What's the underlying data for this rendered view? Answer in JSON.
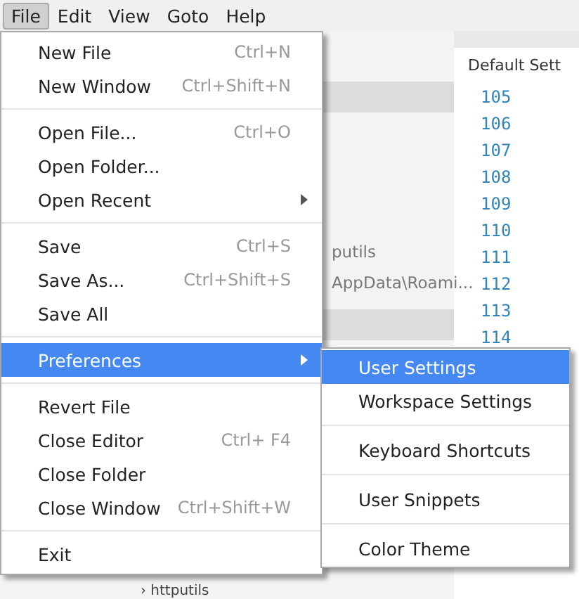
{
  "menubar": [
    {
      "label": "File",
      "selected": true
    },
    {
      "label": "Edit",
      "selected": false
    },
    {
      "label": "View",
      "selected": false
    },
    {
      "label": "Goto",
      "selected": false
    },
    {
      "label": "Help",
      "selected": false
    }
  ],
  "sidebar": {
    "items": [
      {
        "selected": true
      },
      {
        "label": "putils",
        "selected": false
      },
      {
        "label": "AppData\\Roami...",
        "selected": false
      },
      {
        "selected": true
      }
    ],
    "footer": "› httputils"
  },
  "editor": {
    "tab": "Default Sett",
    "line_numbers": [
      "105",
      "106",
      "107",
      "108",
      "109",
      "110",
      "111",
      "112",
      "113",
      "114"
    ]
  },
  "file_menu": [
    {
      "kind": "item",
      "label": "New File",
      "shortcut": "Ctrl+N",
      "submenu": false,
      "selected": false
    },
    {
      "kind": "item",
      "label": "New Window",
      "shortcut": "Ctrl+Shift+N",
      "submenu": false,
      "selected": false
    },
    {
      "kind": "separator"
    },
    {
      "kind": "item",
      "label": "Open File...",
      "shortcut": "Ctrl+O",
      "submenu": false,
      "selected": false
    },
    {
      "kind": "item",
      "label": "Open Folder...",
      "submenu": false,
      "selected": false
    },
    {
      "kind": "item",
      "label": "Open Recent",
      "submenu": true,
      "selected": false
    },
    {
      "kind": "separator"
    },
    {
      "kind": "item",
      "label": "Save",
      "shortcut": "Ctrl+S",
      "submenu": false,
      "selected": false
    },
    {
      "kind": "item",
      "label": "Save As...",
      "shortcut": "Ctrl+Shift+S",
      "submenu": false,
      "selected": false
    },
    {
      "kind": "item",
      "label": "Save All",
      "submenu": false,
      "selected": false
    },
    {
      "kind": "separator"
    },
    {
      "kind": "item",
      "label": "Preferences",
      "submenu": true,
      "selected": true
    },
    {
      "kind": "separator"
    },
    {
      "kind": "item",
      "label": "Revert File",
      "submenu": false,
      "selected": false
    },
    {
      "kind": "item",
      "label": "Close Editor",
      "shortcut": "Ctrl+  F4",
      "submenu": false,
      "selected": false
    },
    {
      "kind": "item",
      "label": "Close Folder",
      "submenu": false,
      "selected": false
    },
    {
      "kind": "item",
      "label": "Close Window",
      "shortcut": "Ctrl+Shift+W",
      "submenu": false,
      "selected": false
    },
    {
      "kind": "separator"
    },
    {
      "kind": "item",
      "label": "Exit",
      "submenu": false,
      "selected": false
    }
  ],
  "preferences_menu": [
    {
      "kind": "item",
      "label": "User Settings",
      "selected": true
    },
    {
      "kind": "item",
      "label": "Workspace Settings",
      "selected": false
    },
    {
      "kind": "separator"
    },
    {
      "kind": "item",
      "label": "Keyboard Shortcuts",
      "selected": false
    },
    {
      "kind": "separator"
    },
    {
      "kind": "item",
      "label": "User Snippets",
      "selected": false
    },
    {
      "kind": "separator"
    },
    {
      "kind": "item",
      "label": "Color Theme",
      "selected": false
    }
  ]
}
